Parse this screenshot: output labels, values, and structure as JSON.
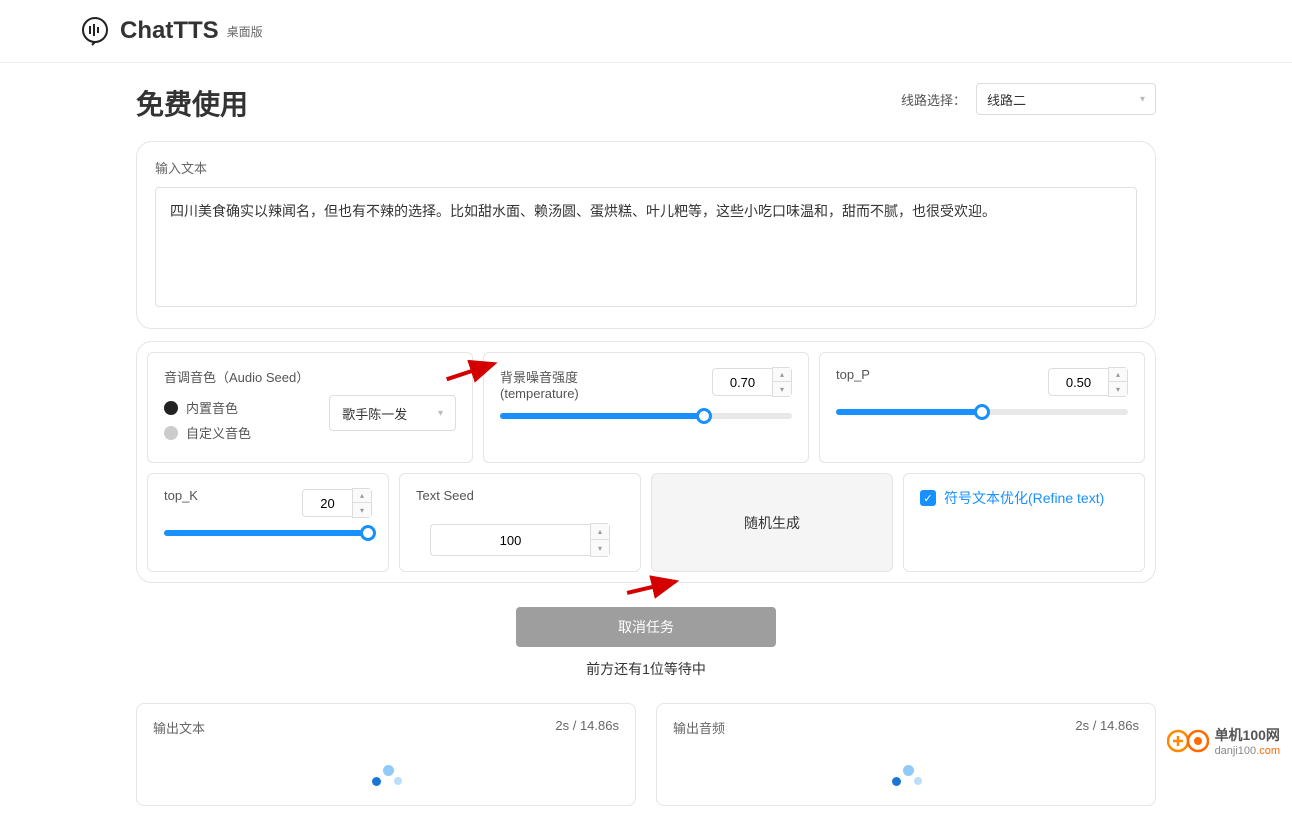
{
  "header": {
    "brand": "ChatTTS",
    "sub": "桌面版"
  },
  "page": {
    "title": "免费使用"
  },
  "route": {
    "label": "线路选择：",
    "selected": "线路二"
  },
  "input_card": {
    "label": "输入文本",
    "text": "四川美食确实以辣闻名，但也有不辣的选择。比如甜水面、赖汤圆、蛋烘糕、叶儿粑等，这些小吃口味温和，甜而不腻，也很受欢迎。"
  },
  "voice": {
    "label": "音调音色（Audio Seed）",
    "radio_builtin": "内置音色",
    "radio_custom": "自定义音色",
    "selected_voice": "歌手陈一发"
  },
  "params": {
    "temperature": {
      "label": "背景噪音强度(temperature)",
      "value": "0.70",
      "percent": 70
    },
    "top_p": {
      "label": "top_P",
      "value": "0.50",
      "percent": 50
    },
    "top_k": {
      "label": "top_K",
      "value": "20",
      "percent": 100
    },
    "text_seed": {
      "label": "Text Seed",
      "value": "100"
    },
    "random_btn": "随机生成",
    "refine": {
      "label": "符号文本优化(Refine text)"
    }
  },
  "actions": {
    "cancel": "取消任务",
    "waiting": "前方还有1位等待中"
  },
  "output": {
    "text_label": "输出文本",
    "audio_label": "输出音频",
    "timing": "2s / 14.86s"
  },
  "watermark": {
    "brand": "单机100网",
    "url": "danji100",
    "tld": ".com"
  }
}
